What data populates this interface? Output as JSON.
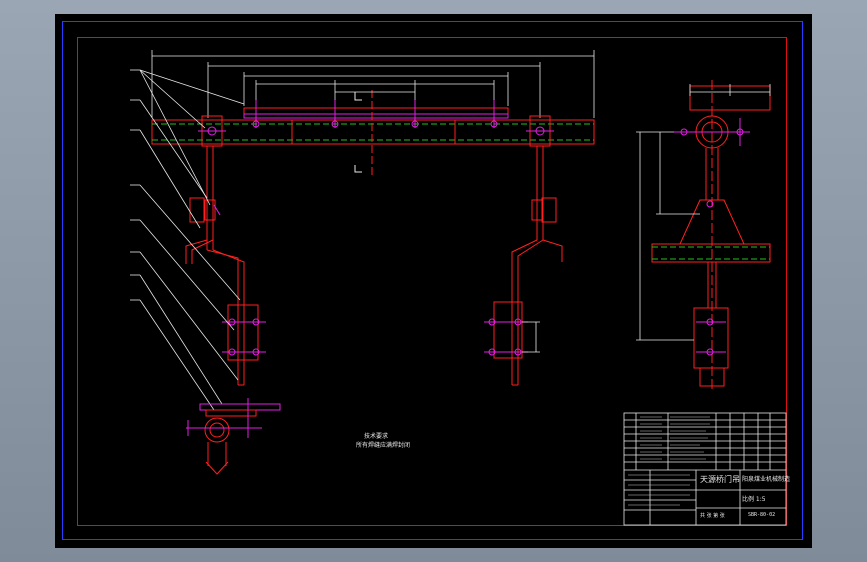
{
  "notes": {
    "line1": "技术要求",
    "line2": "所有焊缝应满焊封闭"
  },
  "title_block": {
    "drawing_name": "天源桥门吊",
    "company": "阳泉煤业机械制造",
    "ratio": "比例 1:5",
    "code": "SBR-80-02",
    "sheet": "共 张 第 张"
  },
  "colors": {
    "bg": "#000000",
    "red": "#ff2020",
    "white": "#f0f0f0",
    "green": "#20c020",
    "magenta": "#e020e0",
    "blue": "#3040ff"
  }
}
